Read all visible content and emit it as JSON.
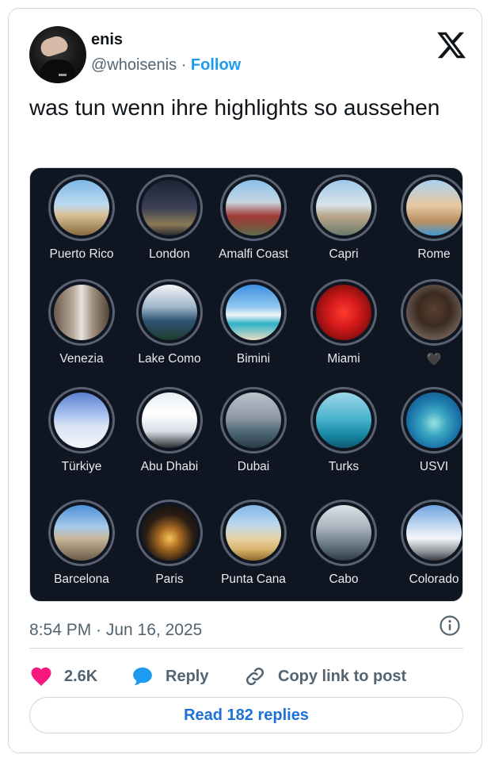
{
  "author": {
    "name": "enis",
    "handle": "@whoisenis",
    "separator": "·",
    "follow_label": "Follow"
  },
  "tweet": {
    "text": "was tun wenn ihre highlights so aussehen",
    "timestamp": "8:54 PM · Jun 16, 2025"
  },
  "highlights": [
    {
      "label": "Puerto Rico",
      "icon": "beach-palm-thumbnail"
    },
    {
      "label": "London",
      "icon": "big-ben-thumbnail"
    },
    {
      "label": "Amalfi Coast",
      "icon": "amalfi-coast-thumbnail"
    },
    {
      "label": "Capri",
      "icon": "capri-terrace-thumbnail"
    },
    {
      "label": "Rome",
      "icon": "colosseum-thumbnail"
    },
    {
      "label": "Venezia",
      "icon": "venice-canal-thumbnail"
    },
    {
      "label": "Lake Como",
      "icon": "lake-view-thumbnail"
    },
    {
      "label": "Bimini",
      "icon": "tropical-beach-thumbnail"
    },
    {
      "label": "Miami",
      "icon": "red-flowers-thumbnail"
    },
    {
      "label": "🖤",
      "icon": "person-thumbnail"
    },
    {
      "label": "Türkiye",
      "icon": "hot-air-balloon-thumbnail"
    },
    {
      "label": "Abu Dhabi",
      "icon": "mosque-thumbnail"
    },
    {
      "label": "Dubai",
      "icon": "rooftop-pool-thumbnail"
    },
    {
      "label": "Turks",
      "icon": "ocean-swing-thumbnail"
    },
    {
      "label": "USVI",
      "icon": "island-aerial-thumbnail"
    },
    {
      "label": "Barcelona",
      "icon": "city-skyline-thumbnail"
    },
    {
      "label": "Paris",
      "icon": "eiffel-tower-night-thumbnail"
    },
    {
      "label": "Punta Cana",
      "icon": "coconut-beach-thumbnail"
    },
    {
      "label": "Cabo",
      "icon": "hotel-pool-thumbnail"
    },
    {
      "label": "Colorado",
      "icon": "snowy-mountain-thumbnail"
    }
  ],
  "actions": {
    "likes": "2.6K",
    "reply_label": "Reply",
    "copy_label": "Copy link to post",
    "read_replies_label": "Read 182 replies"
  },
  "colors": {
    "accent": "#1d9bf0",
    "like": "#f91880",
    "media_background": "#0f1621"
  }
}
